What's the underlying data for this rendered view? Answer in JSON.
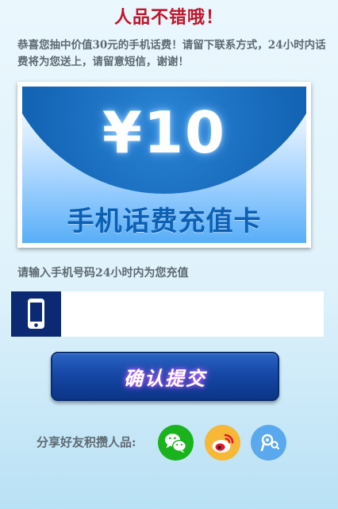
{
  "page": {
    "title": "人品不错哦！",
    "notice": "恭喜您抽中价值30元的手机话费！请留下联系方式，24小时内话费将为您送上，请留意短信，谢谢！"
  },
  "card": {
    "value": "¥10",
    "name": "手机话费充值卡"
  },
  "form": {
    "prompt": "请输入手机号码24小时内为您充值",
    "phone_value": "",
    "phone_placeholder": "",
    "phone_icon": "mobile-phone-icon",
    "submit_label": "确认提交"
  },
  "share": {
    "label": "分享好友积攒人品:",
    "targets": [
      {
        "icon": "wechat-icon",
        "color": "#1ab31d"
      },
      {
        "icon": "weibo-icon",
        "color": "#f7b737"
      },
      {
        "icon": "tencent-weibo-icon",
        "color": "#5aa9ee"
      }
    ]
  },
  "colors": {
    "title": "#c0152b",
    "button": "#1648a6",
    "phone_icon_bg": "#0b2a73"
  }
}
